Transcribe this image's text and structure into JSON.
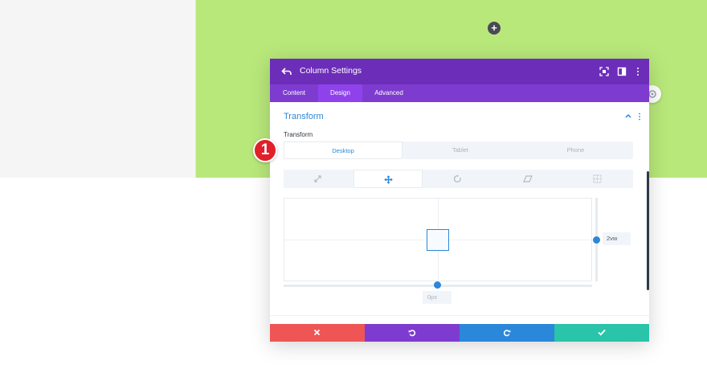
{
  "modal": {
    "title": "Column Settings",
    "tabs": [
      {
        "label": "Content",
        "active": false
      },
      {
        "label": "Design",
        "active": true
      },
      {
        "label": "Advanced",
        "active": false
      }
    ]
  },
  "section": {
    "title": "Transform",
    "field_label": "Transform"
  },
  "device_tabs": [
    {
      "label": "Desktop",
      "active": true
    },
    {
      "label": "Tablet",
      "active": false
    },
    {
      "label": "Phone",
      "active": false
    }
  ],
  "transform_tabs": [
    {
      "icon": "scale-icon",
      "active": false
    },
    {
      "icon": "translate-icon",
      "active": true
    },
    {
      "icon": "rotate-icon",
      "active": false
    },
    {
      "icon": "skew-icon",
      "active": false
    },
    {
      "icon": "origin-icon",
      "active": false
    }
  ],
  "translate": {
    "y_value": "2vw",
    "x_placeholder": "0px"
  },
  "callout": {
    "number": "1"
  },
  "colors": {
    "header": "#6c2eb9",
    "tabs_bar": "#7e3bd0",
    "accent": "#2b87da",
    "row_bg": "#b8e87a",
    "cancel": "#ef5555",
    "undo": "#7e3bd0",
    "redo": "#2b87da",
    "save": "#29c4a9"
  }
}
